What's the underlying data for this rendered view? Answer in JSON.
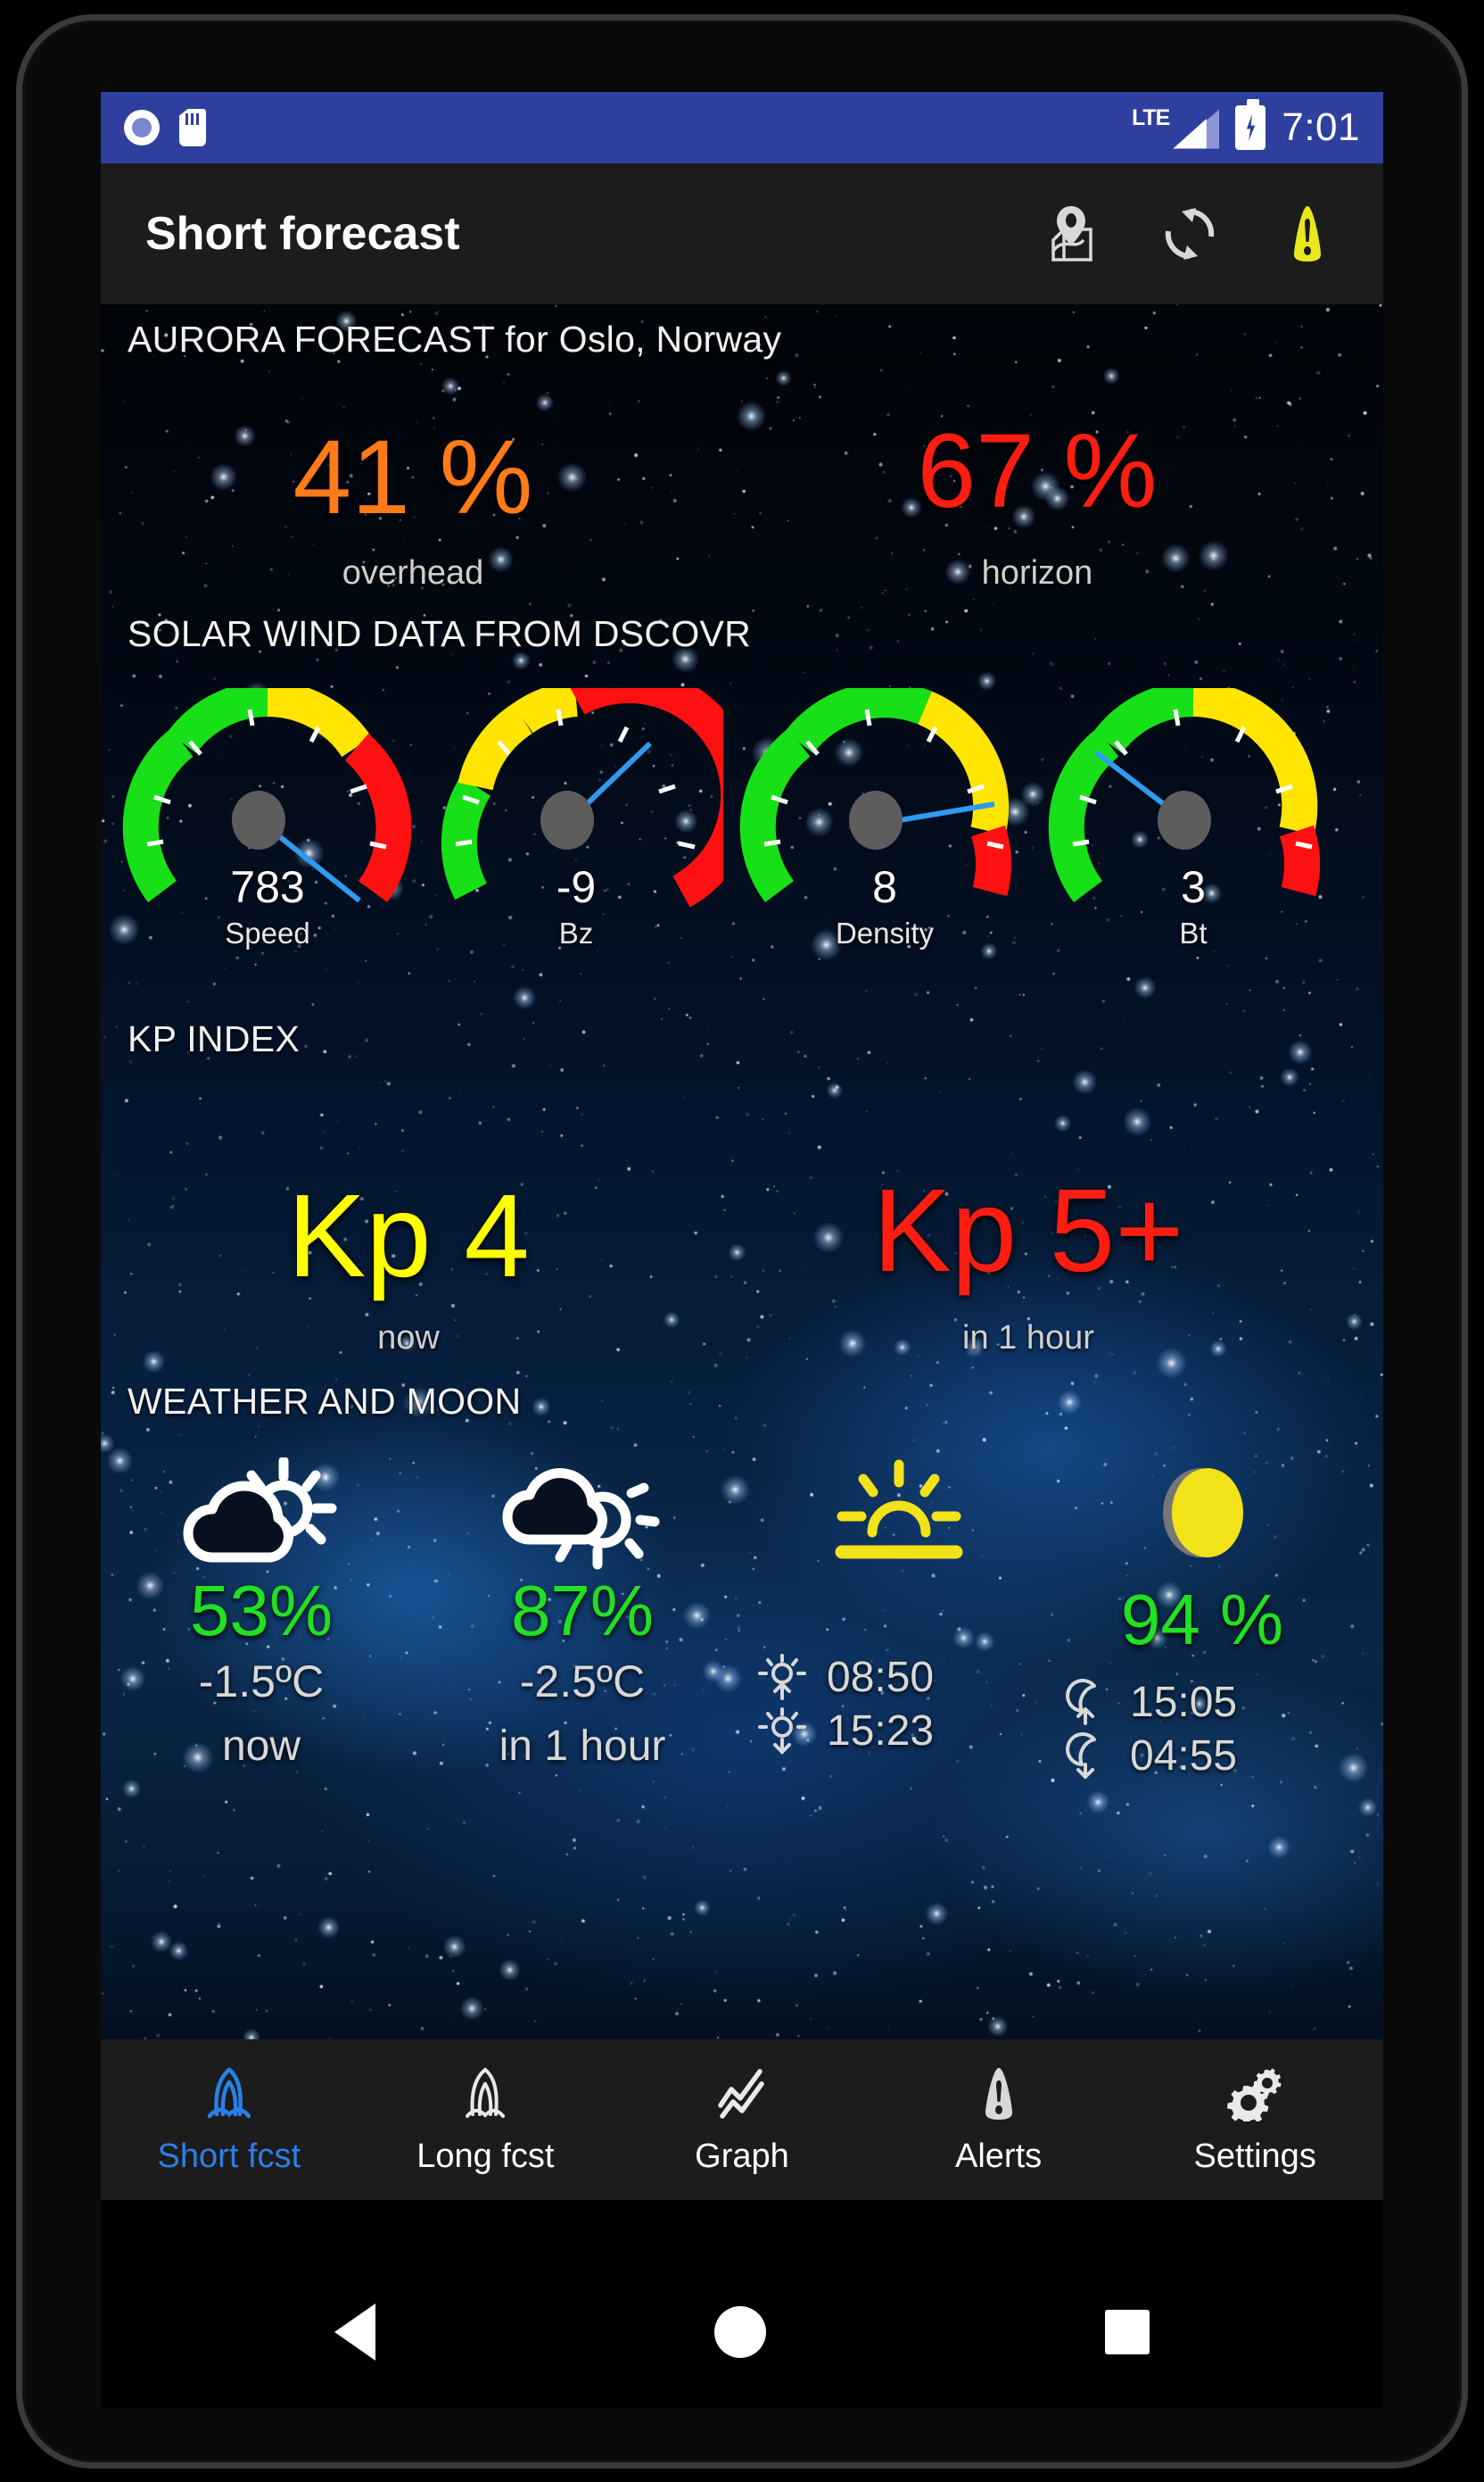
{
  "status_bar": {
    "time": "7:01",
    "network_label": "LTE",
    "icons": [
      "camera-icon",
      "sd-card-icon",
      "lte-signal-icon",
      "battery-charging-icon"
    ]
  },
  "app_bar": {
    "title": "Short forecast",
    "actions": [
      {
        "name": "map-location-icon",
        "label": "Map"
      },
      {
        "name": "refresh-icon",
        "label": "Refresh"
      },
      {
        "name": "warning-icon",
        "label": "Alerts"
      }
    ]
  },
  "aurora": {
    "heading": "AURORA FORECAST for Oslo, Norway",
    "overhead": {
      "value": "41 %",
      "label": "overhead",
      "color": "#ff7a18"
    },
    "horizon": {
      "value": "67 %",
      "label": "horizon",
      "color": "#ff1d12"
    }
  },
  "solar_wind": {
    "heading": "SOLAR WIND DATA FROM DSCOVR",
    "gauges": [
      {
        "value": "783",
        "label": "Speed"
      },
      {
        "value": "-9",
        "label": "Bz"
      },
      {
        "value": "8",
        "label": "Density"
      },
      {
        "value": "3",
        "label": "Bt"
      }
    ]
  },
  "kp_index": {
    "heading": "KP INDEX",
    "now": {
      "value": "Kp 4",
      "label": "now",
      "color": "#ffff00"
    },
    "next": {
      "value": "Kp 5+",
      "label": "in 1 hour",
      "color": "#ff1d12"
    }
  },
  "weather_moon": {
    "heading": "WEATHER AND MOON",
    "now": {
      "icon": "partly-cloudy-icon",
      "cloud_cover": "53%",
      "temperature": "-1.5ºC",
      "when": "now"
    },
    "next": {
      "icon": "rain-sun-icon",
      "cloud_cover": "87%",
      "temperature": "-2.5ºC",
      "when": "in 1 hour"
    },
    "sun": {
      "icon": "sunrise-icon",
      "sunrise": "08:50",
      "sunset": "15:23"
    },
    "moon": {
      "icon": "moon-phase-icon",
      "illumination": "94 %",
      "moonrise": "15:05",
      "moonset": "04:55"
    }
  },
  "bottom_nav": {
    "items": [
      {
        "label": "Short fcst",
        "icon": "aurora-icon",
        "active": true
      },
      {
        "label": "Long fcst",
        "icon": "aurora-outline-icon",
        "active": false
      },
      {
        "label": "Graph",
        "icon": "line-chart-icon",
        "active": false
      },
      {
        "label": "Alerts",
        "icon": "warning-icon",
        "active": false
      },
      {
        "label": "Settings",
        "icon": "gears-icon",
        "active": false
      }
    ]
  },
  "android_nav": {
    "back": "back-button",
    "home": "home-button",
    "recents": "recents-button"
  },
  "colors": {
    "status_bar": "#2f3f9e",
    "app_bar": "#1c1c1c",
    "accent": "#2b7fe8",
    "green": "#22e022",
    "yellow": "#ffff00",
    "red": "#ff1d12",
    "orange": "#ff7a18"
  }
}
